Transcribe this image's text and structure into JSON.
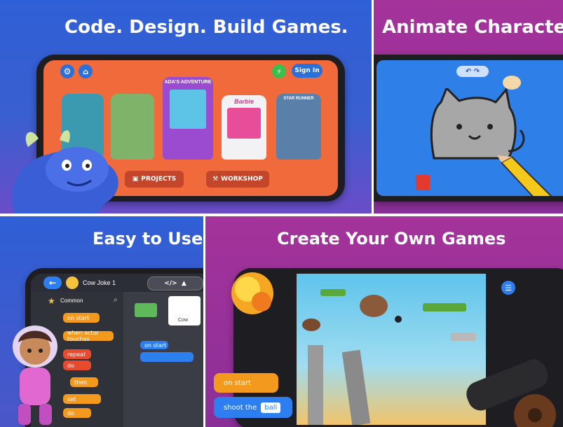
{
  "panels": {
    "code_design": {
      "title": "Code. Design. Build Games."
    },
    "animate": {
      "title": "Animate Characters"
    },
    "easy": {
      "title": "Easy to Use"
    },
    "create": {
      "title": "Create Your Own Games"
    }
  },
  "home_screen": {
    "sign_in": "Sign In",
    "projects": "PROJECTS",
    "workshop": "WORKSHOP",
    "cabinets": [
      "",
      "",
      "ADA'S ADVENTURE",
      "Barbie",
      "STAR RUNNER"
    ]
  },
  "editor_screen": {
    "project_name": "Cow Joke 1",
    "category": "Common",
    "sprite_label": "Cow",
    "blocks": [
      "on start",
      "when actor touches",
      "repeat",
      "do",
      "then",
      "set",
      "do"
    ]
  },
  "game_screen": {
    "on_start": "on start",
    "shoot_the": "shoot the",
    "ball": "ball"
  },
  "colors": {
    "blue_bg": "#2b55c8",
    "purple_bg": "#9b2f8f",
    "orange_screen": "#f06a3c",
    "block_orange": "#f39a1e",
    "block_blue": "#2d7ff0"
  }
}
